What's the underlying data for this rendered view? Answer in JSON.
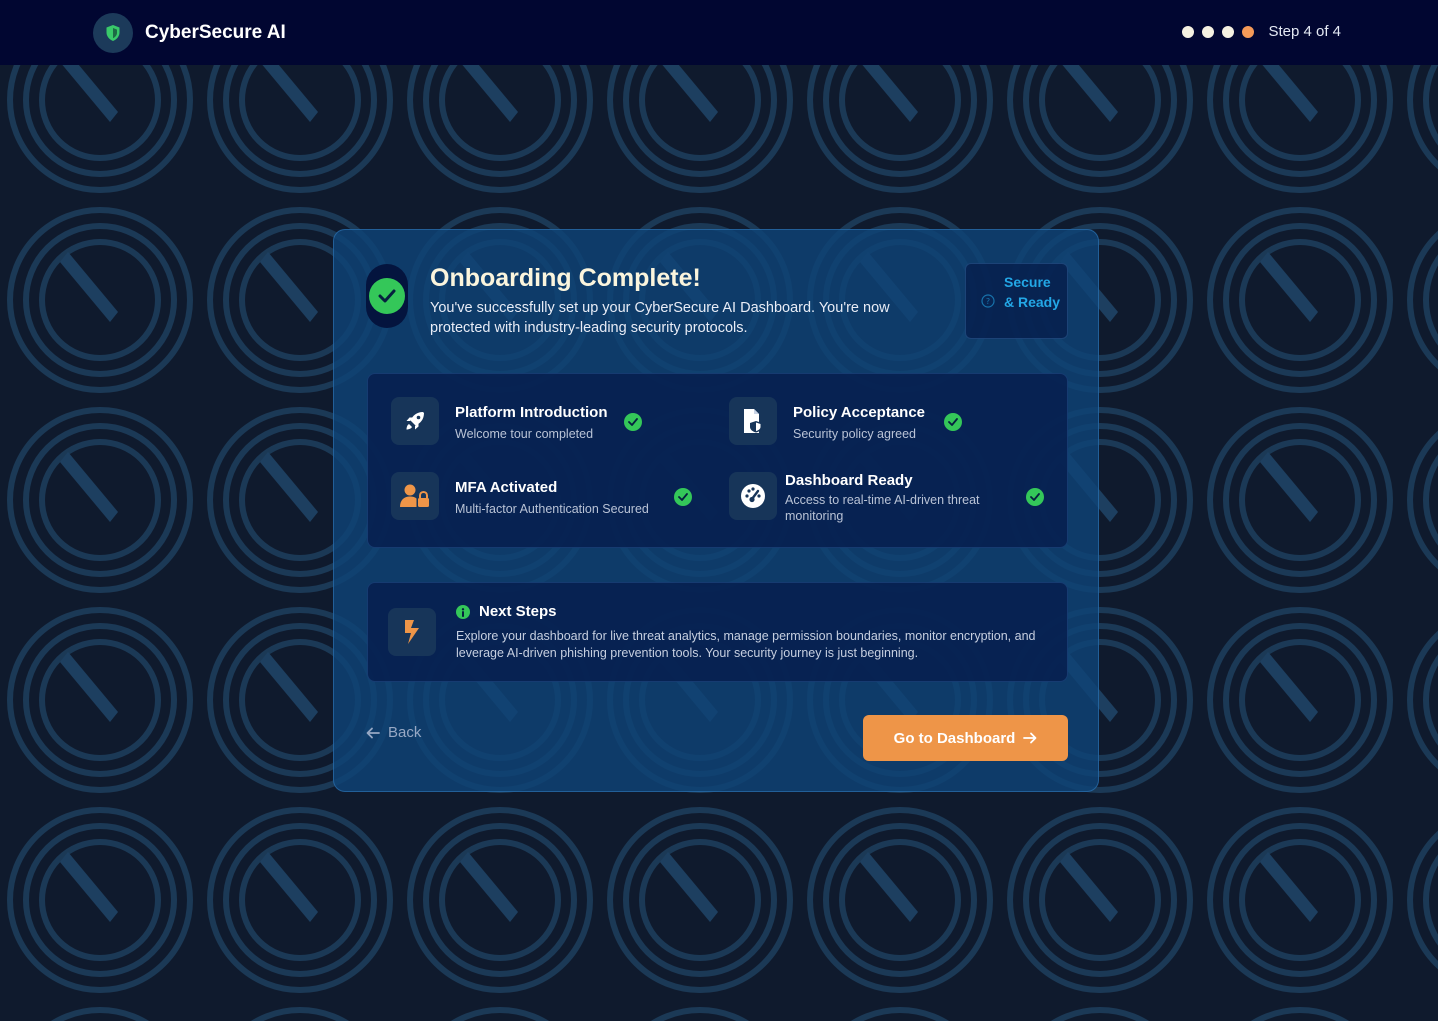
{
  "header": {
    "app_name": "CyberSecure AI",
    "step_text": "Step 4 of 4",
    "progress": {
      "current": 4,
      "total": 4
    },
    "accent_color": "#f59a58"
  },
  "card": {
    "title": "Onboarding Complete!",
    "subtitle": "You've successfully set up your CyberSecure AI Dashboard. You're now protected with industry-leading security protocols.",
    "status_chip": {
      "label": "Secure & Ready",
      "icon": "question-circle-icon"
    }
  },
  "checklist": [
    {
      "title": "Platform Introduction",
      "description": "Welcome tour completed",
      "icon": "rocket-icon",
      "completed": true
    },
    {
      "title": "Policy Acceptance",
      "description": "Security policy agreed",
      "icon": "policy-document-icon",
      "completed": true
    },
    {
      "title": "MFA Activated",
      "description": "Multi-factor Authentication Secured",
      "icon": "user-lock-icon",
      "completed": true
    },
    {
      "title": "Dashboard Ready",
      "description": "Access to real-time AI-driven threat monitoring",
      "icon": "gauge-icon",
      "completed": true
    }
  ],
  "next_steps": {
    "title": "Next Steps",
    "body": "Explore your dashboard for live threat analytics, manage permission boundaries, monitor encryption, and leverage AI-driven phishing prevention tools. Your security journey is just beginning.",
    "icon": "lightning-icon"
  },
  "actions": {
    "back_label": "Back",
    "primary_label": "Go to Dashboard"
  },
  "colors": {
    "background": "#0f1a2d",
    "header": "#010631",
    "card": "#0f4376",
    "success": "#34c759",
    "accent": "#ee9548",
    "chip_text": "#23a7e6"
  }
}
